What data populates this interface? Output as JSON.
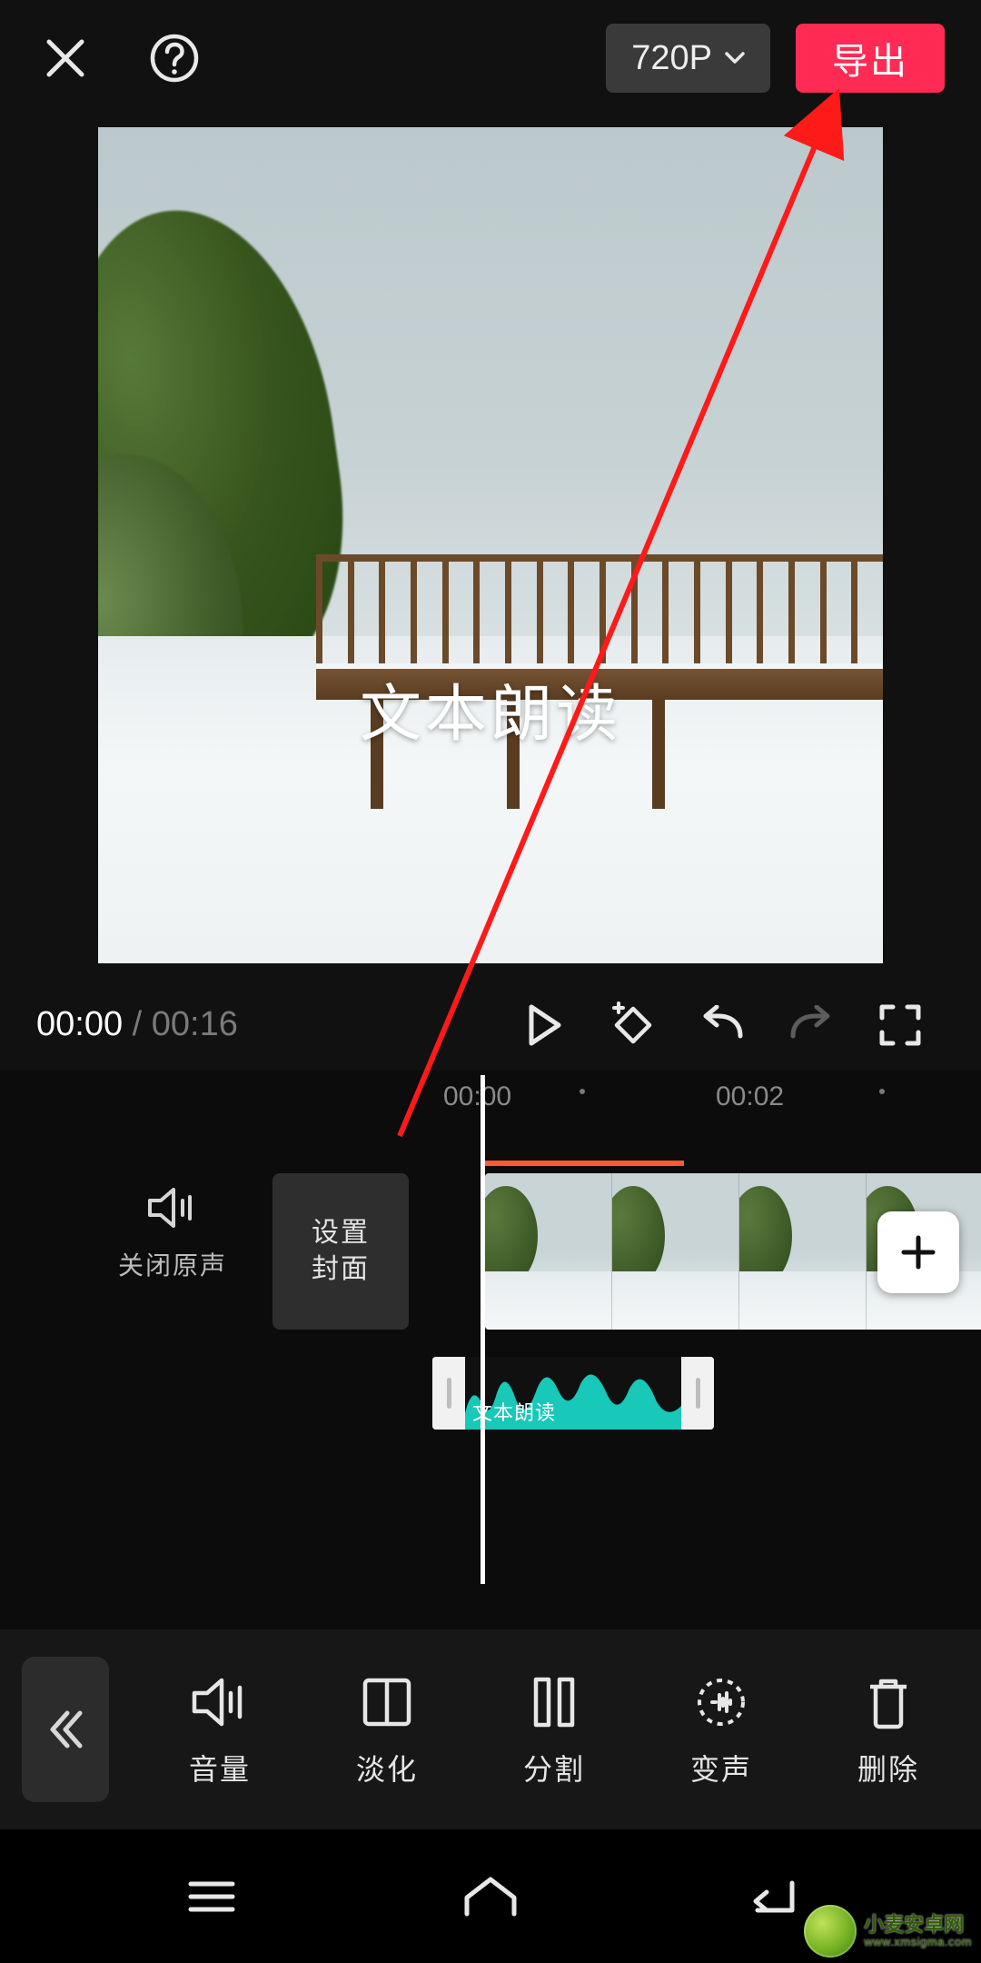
{
  "topbar": {
    "resolution_label": "720P",
    "export_label": "导出"
  },
  "preview": {
    "overlay_text": "文本朗读"
  },
  "transport": {
    "current_time": "00:00",
    "separator": " / ",
    "duration": "00:16"
  },
  "ruler": {
    "marks": [
      "00:00",
      "00:02"
    ]
  },
  "timeline": {
    "mute_label": "关闭原声",
    "cover_label": "设置\n封面",
    "audio_clip_label": "文本朗读"
  },
  "toolbar": {
    "items": [
      {
        "id": "volume",
        "label": "音量"
      },
      {
        "id": "fade",
        "label": "淡化"
      },
      {
        "id": "split",
        "label": "分割"
      },
      {
        "id": "voice",
        "label": "变声"
      },
      {
        "id": "delete",
        "label": "删除"
      }
    ]
  },
  "watermark": {
    "line1": "小麦安卓网",
    "line2": "www.xmsigma.com"
  },
  "colors": {
    "accent": "#ff2b55",
    "orange": "#ff5b2e",
    "teal": "#18c8b8"
  }
}
